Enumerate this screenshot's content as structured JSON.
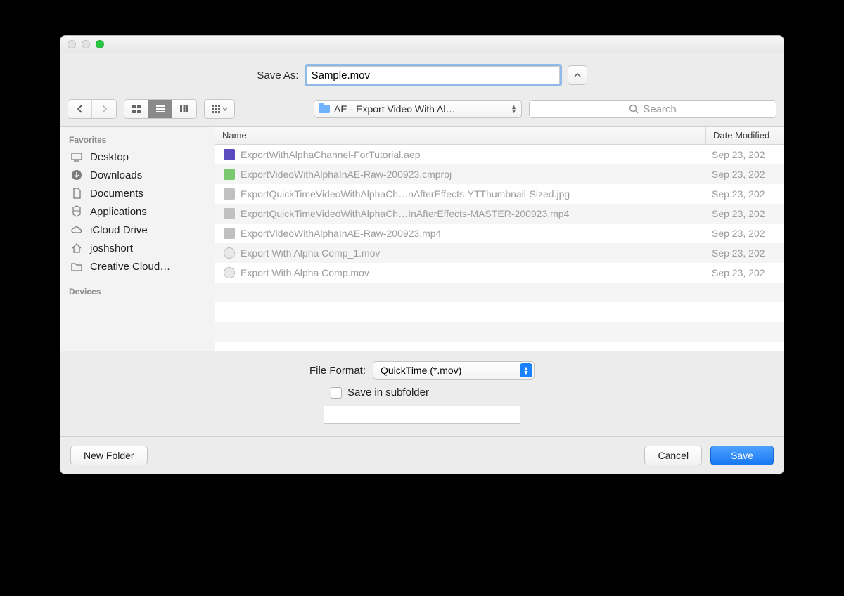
{
  "saveas": {
    "label": "Save As:",
    "value": "Sample.mov"
  },
  "folder": {
    "label": "AE - Export Video With Al…"
  },
  "search": {
    "placeholder": "Search"
  },
  "sidebar": {
    "favorites_label": "Favorites",
    "devices_label": "Devices",
    "items": [
      {
        "label": "Desktop"
      },
      {
        "label": "Downloads"
      },
      {
        "label": "Documents"
      },
      {
        "label": "Applications"
      },
      {
        "label": "iCloud Drive"
      },
      {
        "label": "joshshort"
      },
      {
        "label": "Creative Cloud…"
      }
    ]
  },
  "columns": {
    "name": "Name",
    "date": "Date Modified"
  },
  "files": [
    {
      "name": "ExportWithAlphaChannel-ForTutorial.aep",
      "date": "Sep 23, 202",
      "icon": "aep"
    },
    {
      "name": "ExportVideoWithAlphaInAE-Raw-200923.cmproj",
      "date": "Sep 23, 202",
      "icon": "cm"
    },
    {
      "name": "ExportQuickTimeVideoWithAlphaCh…nAfterEffects-YTThumbnail-Sized.jpg",
      "date": "Sep 23, 202",
      "icon": "jpg"
    },
    {
      "name": "ExportQuickTimeVideoWithAlphaCh…InAfterEffects-MASTER-200923.mp4",
      "date": "Sep 23, 202",
      "icon": "mp4"
    },
    {
      "name": "ExportVideoWithAlphaInAE-Raw-200923.mp4",
      "date": "Sep 23, 202",
      "icon": "mp4"
    },
    {
      "name": "Export With Alpha Comp_1.mov",
      "date": "Sep 23, 202",
      "icon": "mov"
    },
    {
      "name": "Export With Alpha Comp.mov",
      "date": "Sep 23, 202",
      "icon": "mov"
    }
  ],
  "format": {
    "label": "File Format:",
    "value": "QuickTime (*.mov)"
  },
  "subfolder": {
    "label": "Save in subfolder",
    "value": ""
  },
  "buttons": {
    "new_folder": "New Folder",
    "cancel": "Cancel",
    "save": "Save"
  }
}
